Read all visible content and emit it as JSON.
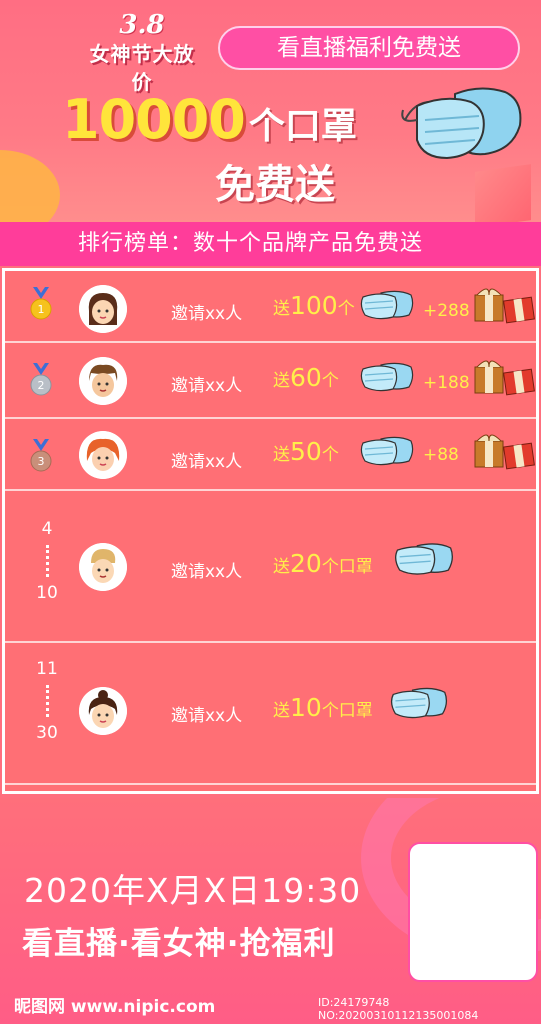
{
  "header": {
    "logo_num": "3.8",
    "logo_text": "女神节大放价",
    "live_button": "看直播福利免费送",
    "title_num": "10000",
    "title_rest": "个口罩",
    "title_sub": "免费送"
  },
  "rank_banner": "排行榜单：数十个品牌产品免费送",
  "ranks": [
    {
      "medal": "1",
      "invite": "邀请xx人",
      "pre": "送",
      "num": "100",
      "suf": "个",
      "bonus": "+288"
    },
    {
      "medal": "2",
      "invite": "邀请xx人",
      "pre": "送",
      "num": "60",
      "suf": "个",
      "bonus": "+188"
    },
    {
      "medal": "3",
      "invite": "邀请xx人",
      "pre": "送",
      "num": "50",
      "suf": "个",
      "bonus": "+88"
    }
  ],
  "tiers": [
    {
      "from": "4",
      "to": "10",
      "invite": "邀请xx人",
      "pre": "送",
      "num": "20",
      "suf": "个口罩"
    },
    {
      "from": "11",
      "to": "30",
      "invite": "邀请xx人",
      "pre": "送",
      "num": "10",
      "suf": "个口罩"
    }
  ],
  "footer": {
    "date": "2020年X月X日19:30",
    "slogan": "看直播·看女神·抢福利",
    "watermark_left": "昵图网 www.nipic.com",
    "watermark_right": "ID:24179748 NO:20200310112135001084"
  },
  "colors": {
    "accent_pink": "#ff3d9a",
    "title_yellow": "#ffe53b",
    "bg": "#ff6f7e"
  }
}
